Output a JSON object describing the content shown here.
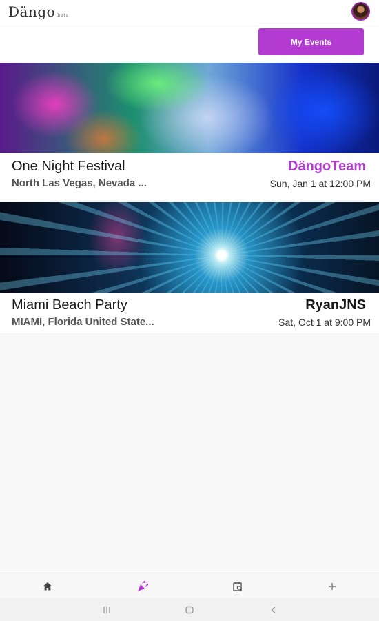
{
  "app": {
    "logo_text": "Dängo",
    "logo_badge": "beta"
  },
  "header": {
    "my_events_label": "My Events"
  },
  "events": [
    {
      "title": "One Night Festival",
      "host": "DängoTeam",
      "host_color": "#b43bd1",
      "location": "North Las Vegas, Nevada ...",
      "datetime": "Sun, Jan 1 at 12:00 PM"
    },
    {
      "title": "Miami Beach Party",
      "host": "RyanJNS",
      "host_color": "#1a1a1a",
      "location": "MIAMI, Florida United State...",
      "datetime": "Sat, Oct 1 at 9:00 PM"
    }
  ],
  "bottom_nav": {
    "items": [
      {
        "icon": "home-icon",
        "active": false
      },
      {
        "icon": "party-popper-icon",
        "active": true
      },
      {
        "icon": "calendar-search-icon",
        "active": false
      },
      {
        "icon": "plus-icon",
        "active": false
      }
    ]
  },
  "colors": {
    "accent": "#b43bd1"
  }
}
